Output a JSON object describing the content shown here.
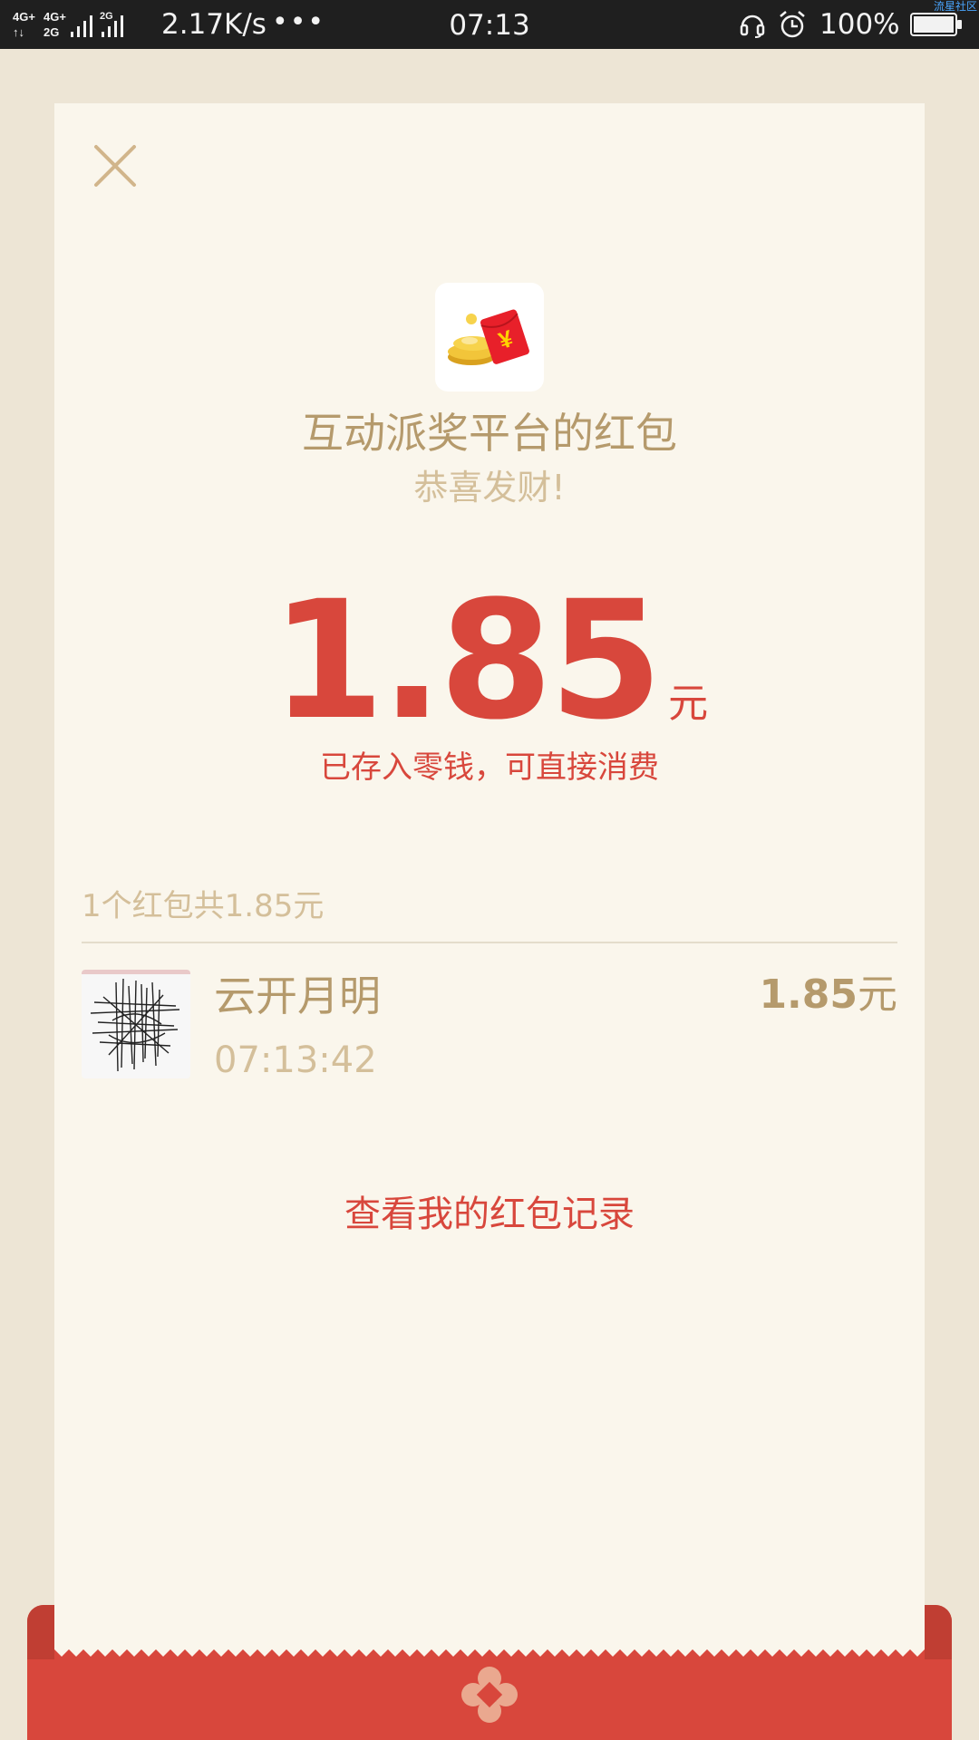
{
  "status_bar": {
    "network_speed": "2.17K/s",
    "more_dots": "•••",
    "time": "07:13",
    "battery_percent": "100%",
    "battery_level": 1.0,
    "corner_text": "流星社区"
  },
  "card": {
    "close_icon": "close-icon",
    "logo_icon": "red-envelope-coins-icon",
    "title": "互动派奖平台的红包",
    "subtitle": "恭喜发财!",
    "amount": "1.85",
    "amount_unit": "元",
    "amount_note": "已存入零钱，可直接消费",
    "summary": "1个红包共1.85元",
    "records": [
      {
        "name": "云开月明",
        "time": "07:13:42",
        "amount": "1.85",
        "unit": "元"
      }
    ],
    "history_link": "查看我的红包记录"
  },
  "colors": {
    "accent_red": "#d8473c",
    "gold_text": "#b59a6c",
    "light_gold_text": "#d4bf9a",
    "card_bg": "#faf6ec",
    "page_bg": "#ede5d5"
  }
}
